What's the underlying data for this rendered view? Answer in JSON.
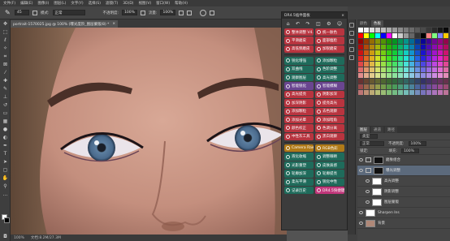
{
  "menu": [
    "文件(F)",
    "编辑(E)",
    "图像(I)",
    "图层(L)",
    "文字(Y)",
    "选择(S)",
    "滤镜(T)",
    "3D(D)",
    "视图(V)",
    "窗口(W)",
    "帮助(H)"
  ],
  "options": {
    "mode_label": "模式:",
    "mode_value": "正常",
    "opacity_label": "不透明度:",
    "opacity_value": "100%",
    "flow_label": "流量:",
    "flow_value": "100%",
    "size_value": "45"
  },
  "document": {
    "tab_title": "portrait-1570025.jpg @ 100% (曝光度阶_图层蒙版/8) *",
    "close": "×"
  },
  "status": {
    "zoom": "100%",
    "doc": "文档:8.2M/27.3M"
  },
  "plugin": {
    "title": "DR4.5插件面板",
    "close": "×",
    "rows": [
      [
        "整体调整 V4.5",
        "统一肤色"
      ],
      [
        "平滑磨皮",
        "面部瘦脸"
      ],
      [
        "高低频磨皮",
        "加锐磨皮"
      ],
      [
        "锐化增强",
        "添加颗粒"
      ],
      [
        "双曲线",
        "色阶调整"
      ],
      [
        "观察图层",
        "高光调整"
      ],
      [
        "智能锐化",
        "智能模糊"
      ],
      [
        "高光提亮",
        "阴影加深"
      ],
      [
        "加深阴影",
        "提亮高光"
      ],
      [
        "添加颗粒",
        "去色观察"
      ],
      [
        "添加光晕",
        "添加暗角"
      ],
      [
        "颜色校正",
        "色调分离"
      ],
      [
        "中性灰工具",
        "黑白观察"
      ],
      [
        "Camera Raw",
        "RGB色彩"
      ],
      [
        "液化收缩",
        "调整眼睛"
      ],
      [
        "光影重塑",
        "皮肤质感"
      ],
      [
        "轮廓加深",
        "轮廓提亮"
      ],
      [
        "柔光平滑",
        "锐化中性"
      ],
      [
        "记录历史",
        "DR4.5快捷键"
      ]
    ],
    "colors": {
      "red": "#b8343f",
      "green": "#1f6b5b",
      "purple": "#6a4590",
      "gold": "#b07a18",
      "pink": "#c0367a"
    }
  },
  "panels": {
    "swatch_tabs": [
      "颜色",
      "色板"
    ],
    "layer_tabs": [
      "图层",
      "通道",
      "路径"
    ],
    "blend_mode": "正常",
    "opacity_label": "不透明度:",
    "opacity_value": "100%",
    "fill_label": "填充:",
    "fill_value": "100%",
    "lock_label": "锁定:",
    "kind_label": "类型",
    "layers": [
      "磨肤组合",
      "曝光调整",
      "高光调整",
      "阴影调整",
      "图层蒙版",
      "Sharpen Ins",
      "背景"
    ]
  }
}
